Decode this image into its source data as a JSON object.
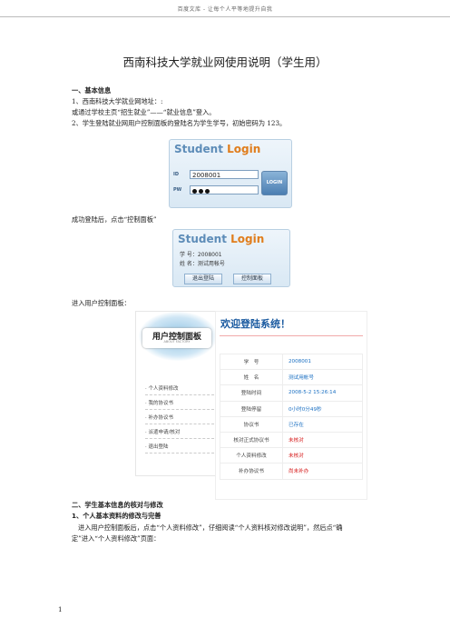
{
  "header": {
    "text": "百度文库 - 让每个人平等地提升自我"
  },
  "doc": {
    "title": "西南科技大学就业网使用说明（学生用）",
    "s1_heading": "一、基本信息",
    "s1_line1": "1、西南科技大学就业网地址：:",
    "s1_line2": "或通过学校主页“招生就业”——“就业信息”登入。",
    "s1_line3": "2、学生登陆就业网用户控制面板的登陆名为学生学号，初始密码为 123。",
    "after_login": "成功登陆后，点击“控制面板”",
    "enter_panel": "进入用户控制面板：",
    "s2_heading": "二、学生基本信息的核对与修改",
    "s2_sub": "1、个人基本资料的修改与完善",
    "s2_para1": "进入用户控制面板后，点击“个人资料修改”，仔细阅读“个人资料核对修改说明”，然后点“确",
    "s2_para2": "定”进入“个人资料修改”页面：",
    "page_number": "1"
  },
  "login": {
    "title_a": "Student ",
    "title_b": "Login",
    "id_label": "ID",
    "pw_label": "PW",
    "id_value": "2008001",
    "button": "LOGIN"
  },
  "login_after": {
    "title_a": "Student ",
    "title_b": "Login",
    "student_no": "学 号：2008001",
    "name": "姓 名：测试用帐号",
    "logout": "退出登陆",
    "control_panel": "控制面板"
  },
  "panel": {
    "title": "用户控制面板",
    "subtitle": "ABOUT FACTORY",
    "items": [
      "个人资料修改",
      "我的协议书",
      "补办协议书",
      "派遣申请/核对",
      "退出登陆"
    ]
  },
  "welcome": {
    "heading": "欢迎登陆系统！",
    "rows": [
      {
        "label": "学　号",
        "value": "2008001",
        "color": "blue"
      },
      {
        "label": "姓　名",
        "value": "测试用帐号",
        "color": "blue"
      },
      {
        "label": "登陆时间",
        "value": "2008-5-2 15:26:14",
        "color": "blue"
      },
      {
        "label": "登陆停留",
        "value": "0小时0分49秒",
        "color": "blue"
      },
      {
        "label": "协议书",
        "value": "已存在",
        "color": "blue"
      },
      {
        "label": "核对正式协议书",
        "value": "未核对",
        "color": "red"
      },
      {
        "label": "个人资料修改",
        "value": "未核对",
        "color": "red"
      },
      {
        "label": "补办协议书",
        "value": "尚未补办",
        "color": "red"
      }
    ]
  }
}
